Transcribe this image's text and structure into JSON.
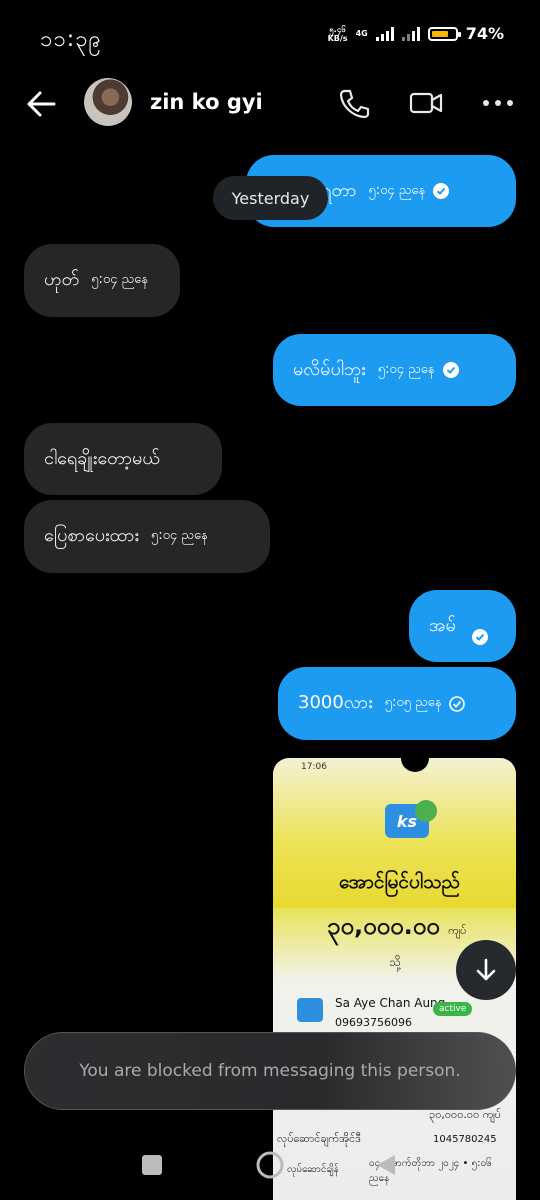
{
  "status_bar": {
    "time": "၁၁:၃၉",
    "net_speed_value": "၅.၄၆",
    "net_speed_unit": "KB/s",
    "network": "4G",
    "battery_percent": "74%",
    "battery_level": 0.74
  },
  "header": {
    "contact_name": "zin ko gyi",
    "avatar_icon": "profile-photo",
    "actions": [
      "back-arrow-icon",
      "phone-icon",
      "video-icon",
      "more-icon"
    ]
  },
  "date_divider": "Yesterday",
  "messages": [
    {
      "dir": "out",
      "text": "ပိုလွဲရတာ",
      "time": "၅:၀၄ ညနေ",
      "status": "seen"
    },
    {
      "dir": "in",
      "text": "ဟုတ်",
      "time": "၅:၀၄ ညနေ"
    },
    {
      "dir": "out",
      "text": "မလိမ်ပါဘူး",
      "time": "၅:၀၄ ညနေ",
      "status": "seen"
    },
    {
      "dir": "in",
      "text": "ငါရေချိုးတော့မယ်",
      "time": ""
    },
    {
      "dir": "in",
      "text": "ပြေစာပေးထား",
      "time": "၅:၀၄ ညနေ"
    },
    {
      "dir": "out",
      "text": "အမ်",
      "time": "",
      "status": "seen"
    },
    {
      "dir": "out",
      "text": "3000လား",
      "time": "၅:၀၅ ညနေ",
      "status": "sent"
    }
  ],
  "media": {
    "phone_time": "17:06",
    "logo_text": "ks",
    "success_text": "အောင်မြင်ပါသည်",
    "amount": "၃၀,၀၀၀.၀၀",
    "currency": "ကျပ်",
    "to_label": "သို့",
    "receiver_name": "Sa Aye Chan Aung",
    "receiver_status": "active",
    "receiver_phone": "09693756096",
    "row_amount": "၃၀,၀၀၀.၀၀ ကျပ်",
    "txid_label": "လုပ်ဆောင်ချက်အိုင်ဒီ",
    "txid_value": "1045780245",
    "date_label": "လုပ်ဆောင်ချိန်",
    "date_value": "၀၄ အောက်တိုဘာ ၂၀၂၄ • ၅:၀၆ ညနေ"
  },
  "blocked_notice": "You are blocked from messaging this person.",
  "colors": {
    "outgoing_bubble": "#1d9bf0",
    "incoming_bubble": "#262626",
    "background": "#000000"
  }
}
